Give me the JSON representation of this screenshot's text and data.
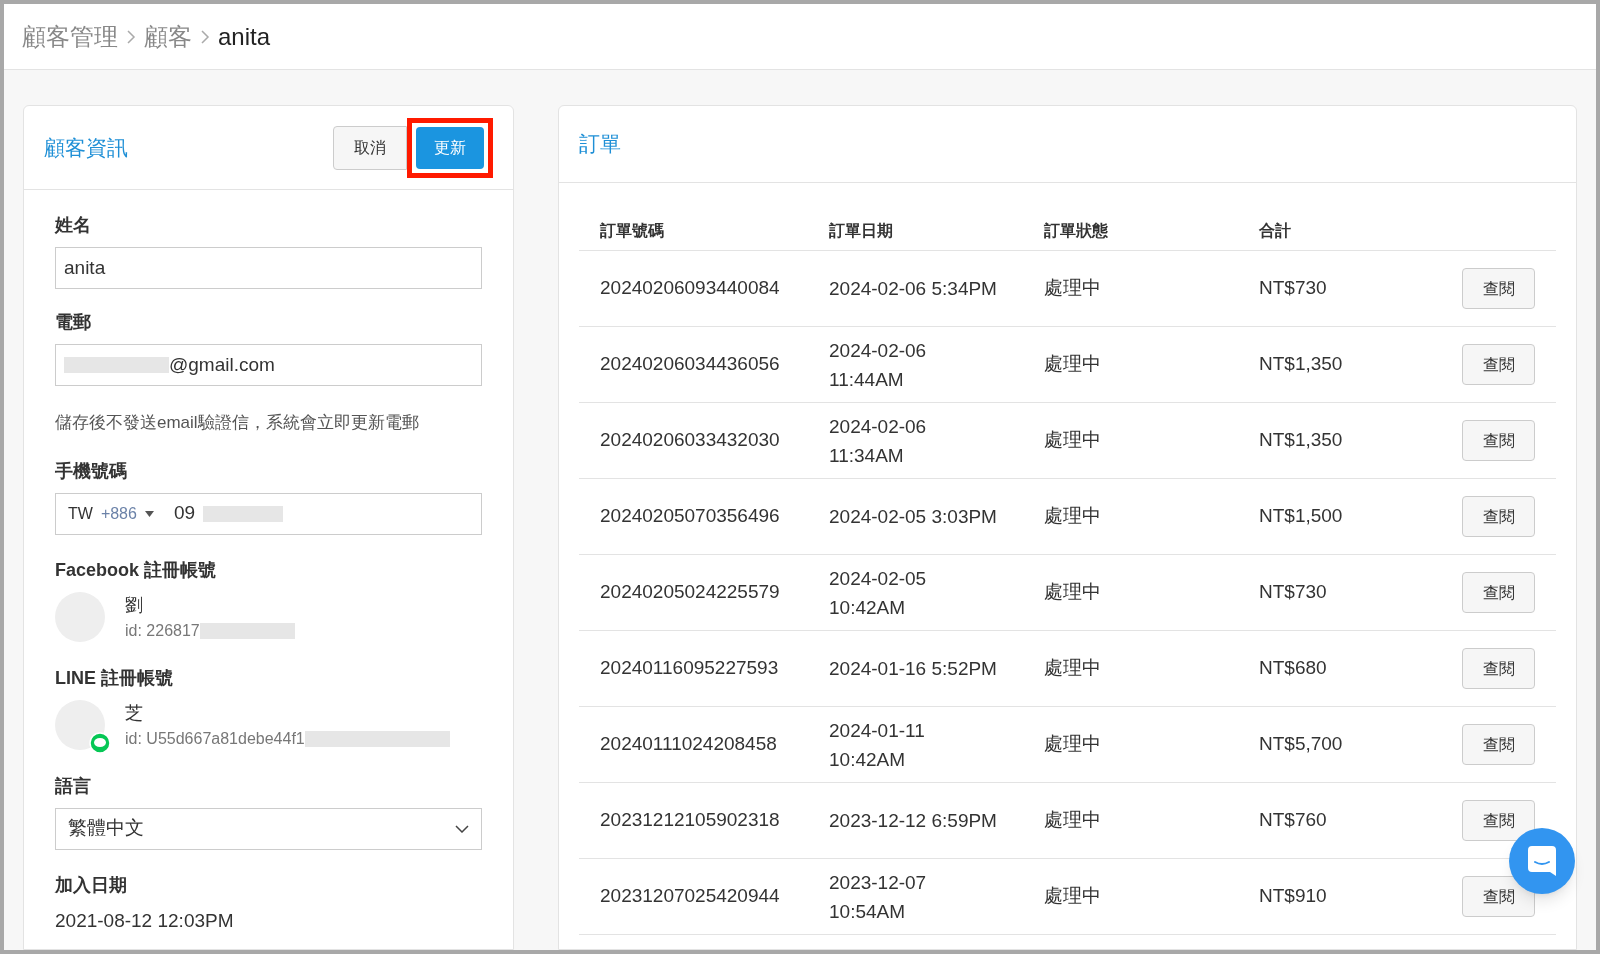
{
  "breadcrumb": [
    {
      "label": "顧客管理",
      "current": false
    },
    {
      "label": "顧客",
      "current": false
    },
    {
      "label": "anita",
      "current": true
    }
  ],
  "customer_card": {
    "title": "顧客資訊",
    "cancel_button": "取消",
    "update_button": "更新",
    "update_highlighted": true,
    "name": {
      "label": "姓名",
      "value": "anita"
    },
    "email": {
      "label": "電郵",
      "value": "@gmail.com",
      "redacted": true,
      "note": "儲存後不發送email驗證信，系統會立即更新電郵"
    },
    "phone": {
      "label": "手機號碼",
      "country": "TW",
      "code": "+886",
      "value": "09",
      "redacted": true
    },
    "accounts": [
      {
        "label": "Facebook 註冊帳號",
        "kind": "facebook",
        "name": "劉",
        "id": "id: 226817",
        "redacted": true
      },
      {
        "label": "LINE 註冊帳號",
        "kind": "line",
        "name": "芝",
        "id": "id: U55d667a81debe44f1",
        "redacted": true
      }
    ],
    "language": {
      "label": "語言",
      "value": "繁體中文"
    },
    "joined": {
      "label": "加入日期",
      "value": "2021-08-12 12:03PM"
    }
  },
  "orders": {
    "title": "訂單",
    "columns": [
      "訂單號碼",
      "訂單日期",
      "訂單狀態",
      "合計"
    ],
    "rows": [
      {
        "number": "20240206093440084",
        "date": "2024-02-06 5:34PM",
        "status": "處理中",
        "total": "NT$730",
        "action": "查閱"
      },
      {
        "number": "20240206034436056",
        "date": "2024-02-06 11:44AM",
        "status": "處理中",
        "total": "NT$1,350",
        "action": "查閱"
      },
      {
        "number": "20240206033432030",
        "date": "2024-02-06 11:34AM",
        "status": "處理中",
        "total": "NT$1,350",
        "action": "查閱"
      },
      {
        "number": "20240205070356496",
        "date": "2024-02-05 3:03PM",
        "status": "處理中",
        "total": "NT$1,500",
        "action": "查閱"
      },
      {
        "number": "20240205024225579",
        "date": "2024-02-05 10:42AM",
        "status": "處理中",
        "total": "NT$730",
        "action": "查閱"
      },
      {
        "number": "20240116095227593",
        "date": "2024-01-16 5:52PM",
        "status": "處理中",
        "total": "NT$680",
        "action": "查閱"
      },
      {
        "number": "20240111024208458",
        "date": "2024-01-11 10:42AM",
        "status": "處理中",
        "total": "NT$5,700",
        "action": "查閱"
      },
      {
        "number": "20231212105902318",
        "date": "2023-12-12 6:59PM",
        "status": "處理中",
        "total": "NT$760",
        "action": "查閱"
      },
      {
        "number": "20231207025420944",
        "date": "2023-12-07 10:54AM",
        "status": "處理中",
        "total": "NT$910",
        "action": "查閱"
      }
    ]
  }
}
